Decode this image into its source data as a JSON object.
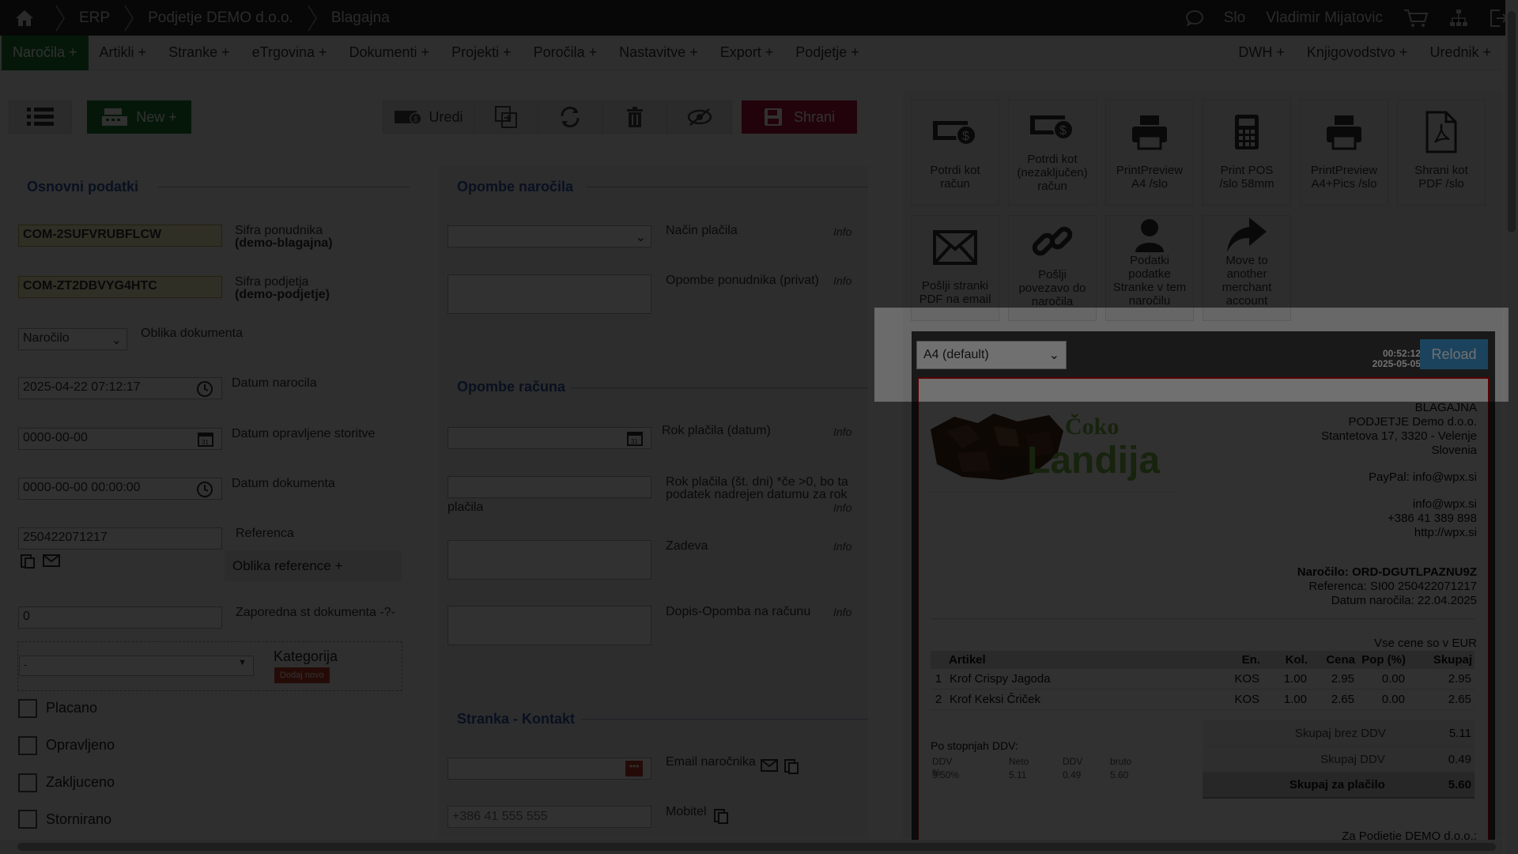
{
  "topbar": {
    "breadcrumbs": [
      "ERP",
      "Podjetje DEMO d.o.o.",
      "Blagajna"
    ],
    "language": "Slo",
    "user": "Vladimir Mijatovic"
  },
  "menu": {
    "left": [
      "Naročila +",
      "Artikli +",
      "Stranke +",
      "eTrgovina +",
      "Dokumenti +",
      "Projekti +",
      "Poročila +",
      "Nastavitve +",
      "Export +",
      "Podjetje +"
    ],
    "right": [
      "DWH +",
      "Knjigovodstvo +",
      "Urednik +"
    ]
  },
  "toolbar": {
    "new_label": "New +",
    "edit_label": "Uredi",
    "save_label": "Shrani"
  },
  "basic": {
    "title": "Osnovni podatki",
    "offerer_code": "COM-2SUFVRUBFLCW",
    "offerer_label": "Sifra ponudnika",
    "offerer_sub": "(demo-blagajna)",
    "company_code": "COM-ZT2DBVYG4HTC",
    "company_label": "Sifra podjetja",
    "company_sub": "(demo-podjetje)",
    "doc_form_value": "Naročilo",
    "doc_form_label": "Oblika dokumenta",
    "order_date": "2025-04-22 07:12:17",
    "order_date_label": "Datum narocila",
    "service_date": "0000-00-00",
    "service_date_label": "Datum opravljene storitve",
    "doc_date": "0000-00-00 00:00:00",
    "doc_date_label": "Datum dokumenta",
    "reference": "250422071217",
    "reference_label": "Referenca",
    "reference_form": "Oblika reference +",
    "seq_no": "0",
    "seq_label": "Zaporedna st dokumenta -?-",
    "category_value": "-",
    "category_label": "Kategorija",
    "category_add": "Dodaj novo",
    "checkboxes": [
      "Placano",
      "Opravljeno",
      "Zakljuceno",
      "Stornirano"
    ]
  },
  "notes": {
    "title": "Opombe naročila",
    "payment_method": "Način plačila",
    "offerer_notes": "Opombe ponudnika (privat)",
    "info": "Info",
    "invoice_title": "Opombe računa",
    "due_date": "Rok plačila (datum)",
    "due_days_a": "Rok plačila (št. dni) *če >0, bo ta",
    "due_days_b": "podatek nadrejen datumu za rok",
    "due_days_c": "plačila",
    "subject": "Zadeva",
    "letter_note": "Dopis-Opomba na računu",
    "contact_title": "Stranka - Kontakt",
    "email_label": "Email naročnika",
    "mobile_label": "Mobitel",
    "mobile_placeholder": "+386 41 555 555"
  },
  "tiles": [
    {
      "name": "confirm-invoice-tile",
      "lines": [
        "Potrdi kot",
        "račun"
      ]
    },
    {
      "name": "confirm-unclosed-tile",
      "lines": [
        "Potrdi kot",
        "(nezaključen)",
        "račun"
      ]
    },
    {
      "name": "print-a4-tile",
      "lines": [
        "PrintPreview",
        "A4 /slo"
      ]
    },
    {
      "name": "print-pos-tile",
      "lines": [
        "Print POS",
        "/slo 58mm"
      ]
    },
    {
      "name": "print-a4-pics-tile",
      "lines": [
        "PrintPreview",
        "A4+Pics /slo"
      ]
    },
    {
      "name": "save-pdf-tile",
      "lines": [
        "Shrani kot",
        "PDF /slo"
      ]
    },
    {
      "name": "send-pdf-email-tile",
      "lines": [
        "Pošlji stranki",
        "PDF na email"
      ]
    },
    {
      "name": "send-link-tile",
      "lines": [
        "Pošlji",
        "povezavo do",
        "naročila"
      ]
    },
    {
      "name": "customer-data-tile",
      "lines": [
        "Podatki",
        "podatke",
        "Stranke v tem",
        "naročilu"
      ]
    },
    {
      "name": "move-merchant-tile",
      "lines": [
        "Move to",
        "another",
        "merchant",
        "account"
      ]
    }
  ],
  "preview": {
    "format": "A4 (default)",
    "time": "00:52:12",
    "date": "2025-05-05",
    "reload": "Reload"
  },
  "invoice": {
    "logo_top": "Čoko",
    "logo_bottom": "Landija",
    "company": [
      "BLAGAJNA",
      "PODJETJE Demo d.o.o.",
      "Stantetova 17, 3320 - Velenje",
      "Slovenia"
    ],
    "paypal": "PayPal: info@wpx.si",
    "contact": [
      "info@wpx.si",
      "+386 41 389 898",
      "http://wpx.si"
    ],
    "order": "Naročilo: ORD-DGUTLPAZNU9Z",
    "reference": "Referenca: SI00 250422071217",
    "order_date": "Datum naročila: 22.04.2025",
    "currency_note": "Vse cene so v EUR",
    "headers": [
      "Artikel",
      "En.",
      "Kol.",
      "Cena",
      "Pop (%)",
      "Skupaj"
    ],
    "rows": [
      [
        "1",
        "Krof Crispy Jagoda",
        "KOS",
        "1.00",
        "2.95",
        "0.00",
        "2.95"
      ],
      [
        "2",
        "Krof Keksi Čriček",
        "KOS",
        "1.00",
        "2.65",
        "0.00",
        "2.65"
      ]
    ],
    "vat_title": "Po stopnjah DDV:",
    "vat_headers": [
      "DDV %",
      "Neto",
      "DDV",
      "bruto"
    ],
    "vat_values": [
      "9.50%",
      "5.11",
      "0.49",
      "5.60"
    ],
    "totals": [
      {
        "label": "Skupaj brez DDV",
        "value": "5.11"
      },
      {
        "label": "Skupaj DDV",
        "value": "0.49"
      },
      {
        "label": "Skupaj za plačilo",
        "value": "5.60"
      }
    ],
    "footer": "Za Podjetje DEMO d.o.o.:"
  },
  "colors": {
    "accent_green": "#1f7a32",
    "save_red": "#b3123e",
    "reload_blue": "#3f9ad6",
    "section_blue": "#2d57a8"
  }
}
